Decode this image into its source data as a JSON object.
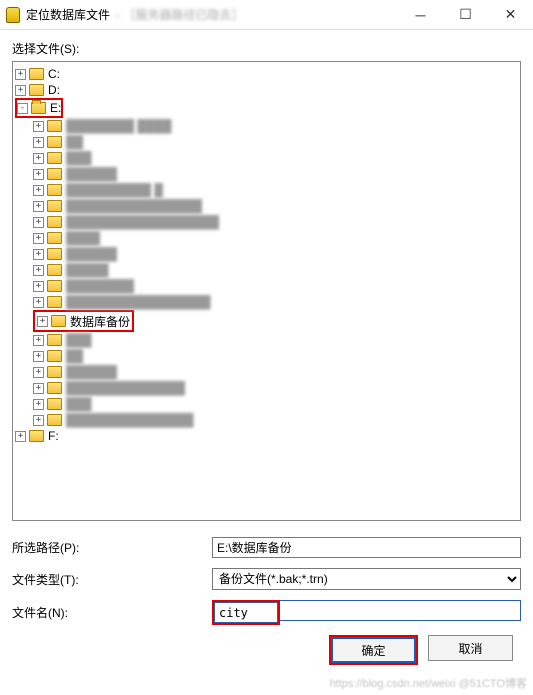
{
  "titlebar": {
    "title": "定位数据库文件",
    "subtitle": "- ［服务器路径已隐去］"
  },
  "labels": {
    "select_file": "选择文件(S):",
    "selected_path": "所选路径(P):",
    "file_type": "文件类型(T):",
    "file_name": "文件名(N):"
  },
  "tree": {
    "c": "C:",
    "d": "D:",
    "e": "E:",
    "e_children": {
      "n0": "████████ ████",
      "n1": "██",
      "n2": "███",
      "n3": "██████",
      "n4": "██████████ █",
      "n5": "████████████████",
      "n6": "██████████████████",
      "n7": "████",
      "n8": "██████",
      "n9": "█████",
      "n10": "████████",
      "n11": "█████████████████",
      "backup": "数据库备份",
      "n12": "███",
      "n13": "██",
      "n14": "██████",
      "n15": "██████████████",
      "n16": "███",
      "n17": "███████████████"
    },
    "f": "F:"
  },
  "fields": {
    "selected_path_value": "E:\\数据库备份",
    "file_type_value": "备份文件(*.bak;*.trn)",
    "file_name_value": "city"
  },
  "buttons": {
    "ok": "确定",
    "cancel": "取消"
  },
  "watermark": "https://blog.csdn.net/weixi @51CTO博客"
}
